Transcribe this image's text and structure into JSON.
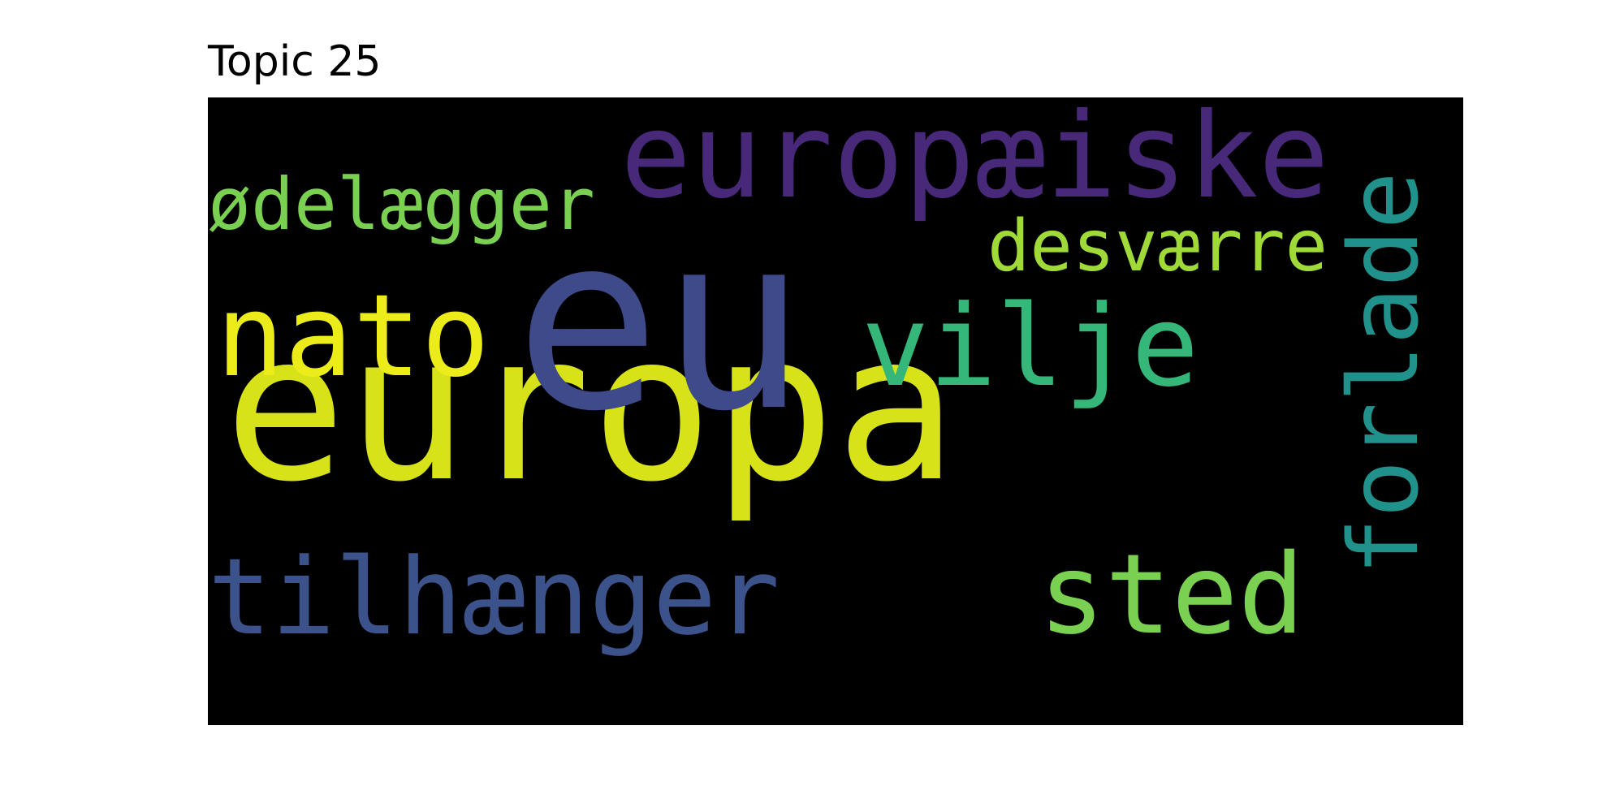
{
  "title": "Topic 25",
  "words": [
    {
      "text": "europa",
      "color": "#d8e219"
    },
    {
      "text": "eu",
      "color": "#3e4a89"
    },
    {
      "text": "europæiske",
      "color": "#482878"
    },
    {
      "text": "ødelægger",
      "color": "#7ad151"
    },
    {
      "text": "desværre",
      "color": "#a0da39"
    },
    {
      "text": "nato",
      "color": "#ecec1a"
    },
    {
      "text": "vilje",
      "color": "#35b779"
    },
    {
      "text": "forlade",
      "color": "#21918c"
    },
    {
      "text": "tilhænger",
      "color": "#3b528b"
    },
    {
      "text": "sted",
      "color": "#7ad151"
    }
  ]
}
